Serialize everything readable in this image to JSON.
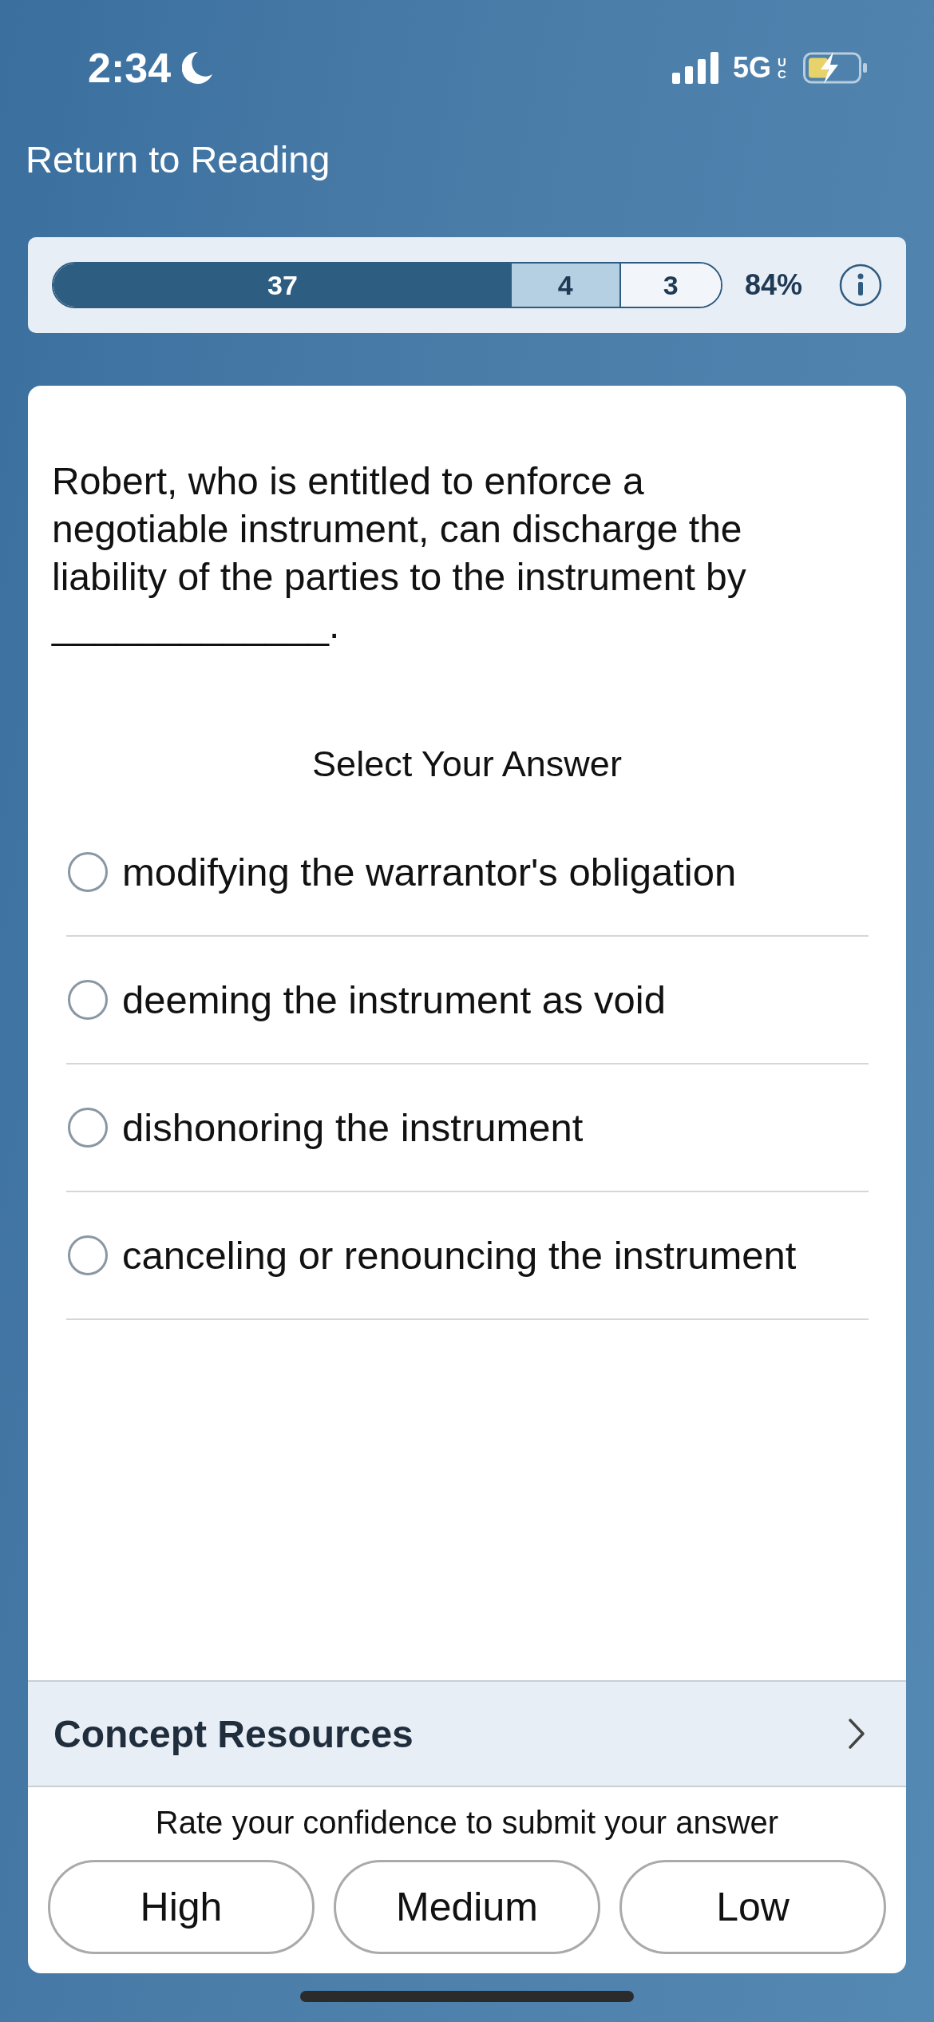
{
  "status_bar": {
    "time": "2:34",
    "network": "5G",
    "network_suffix": "UC"
  },
  "back_link": "Return to Reading",
  "progress": {
    "level": 0.85,
    "segments": [
      {
        "label": "37",
        "kind": "correct",
        "level": 0.81
      },
      {
        "label": "4",
        "kind": "partial"
      },
      {
        "label": "3",
        "kind": "remaining"
      }
    ],
    "percent": "84%"
  },
  "question": {
    "text": "Robert, who is entitled to enforce a negotiable instrument, can discharge the liability of the parties to the instrument by _____________."
  },
  "answer_heading": "Select Your Answer",
  "options": [
    {
      "label": "modifying the warrantor's obligation",
      "selected": false
    },
    {
      "label": "deeming the instrument as void",
      "selected": false
    },
    {
      "label": "dishonoring the instrument",
      "selected": false
    },
    {
      "label": "canceling or renouncing the instrument",
      "selected": false
    }
  ],
  "concept_resources": "Concept Resources",
  "confidence_prompt": "Rate your confidence to submit your answer",
  "confidence_buttons": [
    "High",
    "Medium",
    "Low"
  ]
}
